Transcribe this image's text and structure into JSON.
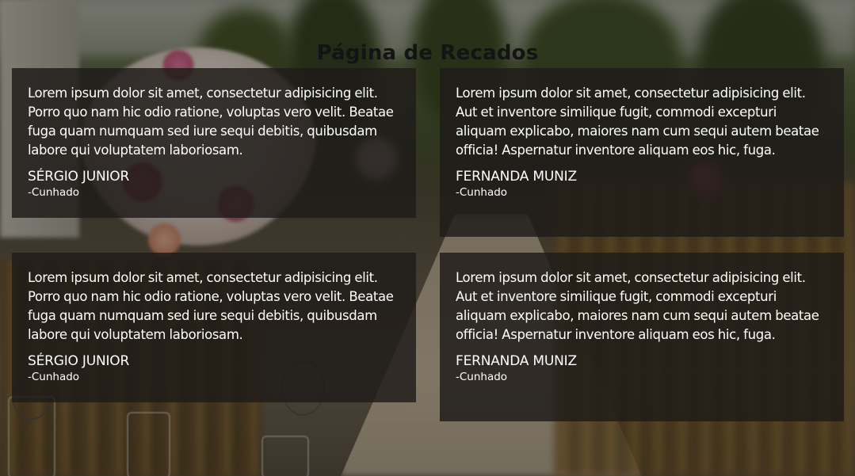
{
  "page": {
    "title": "Página de Recados"
  },
  "messages": [
    {
      "text": "Lorem ipsum dolor sit amet, consectetur adipisicing elit. Porro quo nam hic odio ratione, voluptas vero velit. Beatae fuga quam numquam sed iure sequi debitis, quibusdam labore qui voluptatem laboriosam.",
      "author": "SÉRGIO JUNIOR",
      "relation": "-Cunhado"
    },
    {
      "text": "Lorem ipsum dolor sit amet, consectetur adipisicing elit. Aut et inventore similique fugit, commodi excepturi aliquam explicabo, maiores nam cum sequi autem beatae officia! Aspernatur inventore aliquam eos hic, fuga.",
      "author": "FERNANDA MUNIZ",
      "relation": "-Cunhado"
    },
    {
      "text": "Lorem ipsum dolor sit amet, consectetur adipisicing elit. Porro quo nam hic odio ratione, voluptas vero velit. Beatae fuga quam numquam sed iure sequi debitis, quibusdam labore qui voluptatem laboriosam.",
      "author": "SÉRGIO JUNIOR",
      "relation": "-Cunhado"
    },
    {
      "text": "Lorem ipsum dolor sit amet, consectetur adipisicing elit. Aut et inventore similique fugit, commodi excepturi aliquam explicabo, maiores nam cum sequi autem beatae officia! Aspernatur inventore aliquam eos hic, fuga.",
      "author": "FERNANDA MUNIZ",
      "relation": "-Cunhado"
    }
  ],
  "colors": {
    "card_background": "#1e1b18",
    "title_text": "#141414",
    "card_text": "#ffffff"
  }
}
